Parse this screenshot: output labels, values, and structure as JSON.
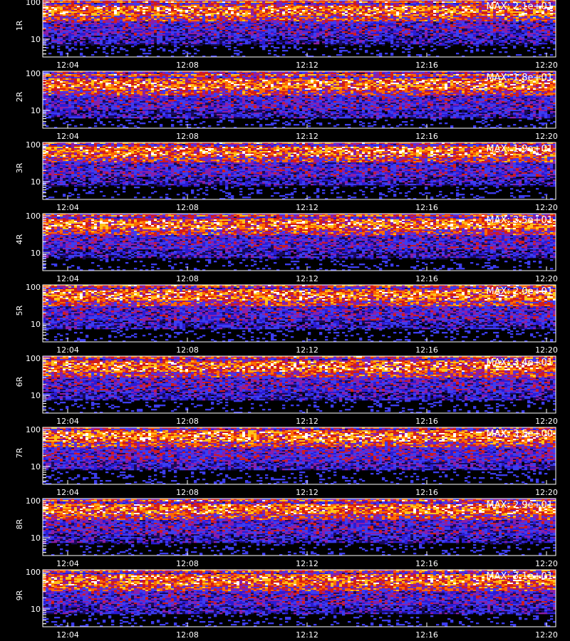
{
  "chart_data": {
    "type": "heatmap",
    "panel_count": 9,
    "x_ticks": [
      "12:04",
      "12:08",
      "12:12",
      "12:16",
      "12:20"
    ],
    "y_ticks": [
      "100",
      "10"
    ],
    "y_scale": "log",
    "colormap": [
      "#000000",
      "#1a0a5c",
      "#2b1bd6",
      "#3d3df0",
      "#8a1fa8",
      "#d01c1c",
      "#ff6a00",
      "#ffc21a",
      "#ffffff"
    ],
    "panels": [
      {
        "label": "1R",
        "max": "MAX: 2.1e+01",
        "band_shift": 0
      },
      {
        "label": "2R",
        "max": "MAX: 1.8e+01",
        "band_shift": -3
      },
      {
        "label": "3R",
        "max": "MAX: 1.9e+01",
        "band_shift": 2
      },
      {
        "label": "4R",
        "max": "MAX: 3.5e+01",
        "band_shift": 0
      },
      {
        "label": "5R",
        "max": "MAX: 2.0e+01",
        "band_shift": 1
      },
      {
        "label": "6R",
        "max": "MAX: 3.4e+01",
        "band_shift": 1
      },
      {
        "label": "7R",
        "max": "MAX: 3.5e+00",
        "band_shift": 3
      },
      {
        "label": "8R",
        "max": "MAX: 2.9e+01",
        "band_shift": 0
      },
      {
        "label": "9R",
        "max": "MAX: 3.1e+01",
        "band_shift": 1
      }
    ]
  }
}
